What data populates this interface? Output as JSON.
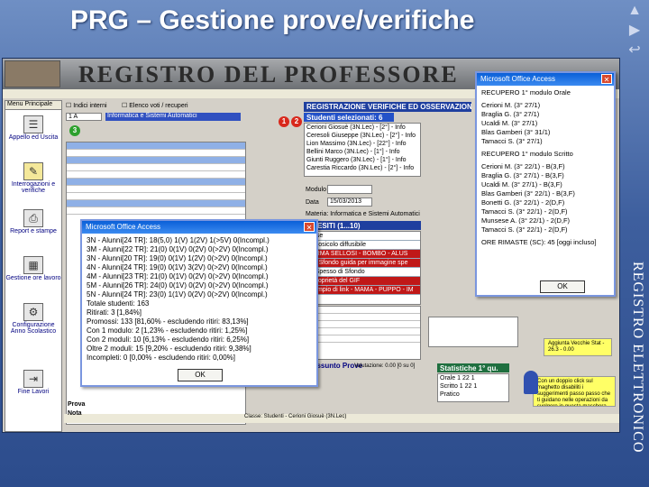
{
  "slide": {
    "title": "PRG – Gestione prove/verifiche",
    "side_label": "REGISTRO ELETTRONICO",
    "nav_icons": [
      "triangle-up-icon",
      "triangle-right-icon",
      "return-icon"
    ]
  },
  "app": {
    "banner_title": "REGISTRO DEL PROFESSORE",
    "menu_header": "Menu Principale",
    "menu_items": [
      {
        "label": "Appello ed Uscita",
        "icon": "roll-call-icon"
      },
      {
        "label": "Interrogazioni e verifiche",
        "icon": "test-icon"
      },
      {
        "label": "Report e stampe",
        "icon": "printer-icon"
      },
      {
        "label": "Gestione ore lavoro",
        "icon": "calendar-icon"
      },
      {
        "label": "Configurazione Anno Scolastico",
        "icon": "config-icon"
      },
      {
        "label": "Fine Lavori",
        "icon": "exit-door-icon"
      }
    ],
    "top_filters": {
      "voti_label": "Indici interni",
      "elenco_label": "Elenco voti / recuperi",
      "classe_value": "1 A",
      "materia_value": "Informatica e Sistemi Automatici"
    },
    "registration_header": "REGISTRAZIONE VERIFICHE ED OSSERVAZIONI - A.S.",
    "student_select": "Studenti selezionati: 6",
    "students": [
      "Cerioni Giosuè (3N.Lec) - [2°] - Info",
      "Ceresoli Giuseppe (3N.Lec) - [2°] - Info",
      "Lion Massimo (3N.Lec) - [22°] - Info",
      "Bellini Marco (3N.Lec) - [1°] - Info",
      "Giunti Ruggero (3N.Lec) - [1°] - Info",
      "Carestia Riccardo (3N.Lec) - [2°] - Info"
    ],
    "modulo_label": "Modulo",
    "data_label": "Data",
    "data_value": "15/03/2013",
    "materia_label": "Materia: Informatica e Sistemi Automatici",
    "quesiti_header": "QUESITI (1...10)",
    "quesiti": [
      "Parse",
      "Macosicolo diffusibile",
      "FORMA SELLOSI - BOMBO - ALUS",
      "286 Sfondo guida per immagine spe",
      "Lo Spesso di Sfondo",
      "1 Proprietà del GIF",
      "Esempio di link - MAMA - PUPPO - IM"
    ],
    "riassunto_label": "Riassunto Prove",
    "valutazione_label": "Valutazione: 0.00 [0 su 0]",
    "stat_header": "Statistiche 1° qu.",
    "stat_rows": [
      {
        "label": "Orale",
        "a": "1",
        "b": "22",
        "c": "1"
      },
      {
        "label": "Scritto",
        "a": "1",
        "b": "22",
        "c": "1"
      },
      {
        "label": "Pratico",
        "a": "",
        "b": "",
        "c": ""
      }
    ],
    "bottom_status": "Classe: Studenti - Cerioni Giosuè (3N.Lec)",
    "yellow_note": "Con un doppio click sul maghetto disabiliti i suggerimenti passo passo che ti guidano nelle operazioni da svolgere in questa maschera",
    "small_note": "Aggiunta Vecchie Stat - 26.3 - 0.00",
    "bottom_labels": [
      "Prova",
      "Nota"
    ]
  },
  "dialog_left": {
    "title": "Microsoft Office Access",
    "lines": [
      "3N - Alunni[24 TR]: 18(5,0) 1(V) 1(2V) 1(>5V) 0(Incompl.)",
      "3M - Alunni[22 TR]: 21(0) 0(1V) 0(2V) 0(>2V) 0(Incompl.)",
      "3N - Alunni[20 TR]: 19(0) 0(1V) 1(2V) 0(>2V) 0(Incompl.)",
      "4N - Alunni[24 TR]: 19(0) 0(1V) 3(2V) 0(>2V) 0(Incompl.)",
      "4M - Alunni[23 TR]: 21(0) 0(1V) 0(2V) 0(>2V) 0(Incompl.)",
      "5M - Alunni[26 TR]: 24(0) 0(1V) 0(2V) 0(>2V) 0(Incompl.)",
      "5N - Alunni[24 TR]: 23(0) 1(1V) 0(2V) 0(>2V) 0(Incompl.)",
      "Totale studenti: 163",
      "Ritirati: 3 [1,84%]",
      "Promossi: 133 [81,60% - escludendo ritiri: 83,13%]",
      "Con 1 modulo: 2 [1,23% - escludendo ritiri: 1,25%]",
      "Con 2 moduli: 10 [6,13% - escludendo ritiri: 6,25%]",
      "Oltre 2 moduli: 15 [9,20% - escludendo ritiri: 9,38%]",
      "Incompleti: 0 [0,00% - escludendo ritiri: 0,00%]"
    ],
    "ok_label": "OK"
  },
  "dialog_right": {
    "title": "Microsoft Office Access",
    "lines": [
      "RECUPERO 1° modulo Orale",
      "",
      "Cerioni M. (3° 27/1)",
      "Braglia G. (3° 27/1)",
      "Ucaldi M. (3° 27/1)",
      "Blas Gamberi (3° 31/1)",
      "Tamacci S. (3° 27/1)",
      "",
      "RECUPERO 1° modulo Scritto",
      "",
      "Cerioni M. (3° 22/1) - B(3,F)",
      "Braglia G. (3° 27/1) - B(3,F)",
      "Ucaldi M. (3° 27/1) - B(3,F)",
      "Blas Gamberi (3° 22/1) - B(3,F)",
      "Bonetti G. (3° 22/1) - 2(D,F)",
      "Tamacci S. (3° 22/1) - 2(D,F)",
      "Munsese A. (3° 22/1) - 2(D,F)",
      "Tamacci S. (3° 22/1) - 2(D,F)",
      "",
      "ORE RIMASTE (SC): 45 [oggi incluso]"
    ],
    "ok_label": "OK"
  }
}
